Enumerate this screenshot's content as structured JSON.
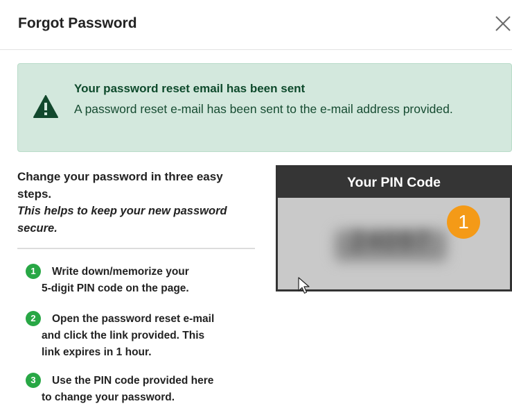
{
  "dialog": {
    "title": "Forgot Password",
    "close_icon": "close-icon"
  },
  "alert": {
    "icon": "warning-triangle-icon",
    "title": "Your password reset email has been sent",
    "message": "A password reset e-mail has been sent to the e-mail address provided.",
    "bg_color": "#d3e8dd",
    "text_color": "#0e4a2c"
  },
  "intro": {
    "heading": "Change your password in three easy steps.",
    "subheading": "This helps to keep your new password secure."
  },
  "steps": [
    {
      "number": "1",
      "line1": "Write down/memorize your",
      "line2": "5-digit PIN code on the page."
    },
    {
      "number": "2",
      "line1": "Open the password reset e-mail",
      "line2": "and click the link provided. This",
      "line3": "link expires in 1 hour."
    },
    {
      "number": "3",
      "line1": "Use the PIN code provided here",
      "line2": "to change your password."
    }
  ],
  "pin": {
    "header": "Your PIN Code",
    "code_obscured": "24097",
    "badge": "1",
    "badge_color": "#f49a17"
  },
  "colors": {
    "step_badge": "#28a745",
    "pin_header": "#353535"
  }
}
